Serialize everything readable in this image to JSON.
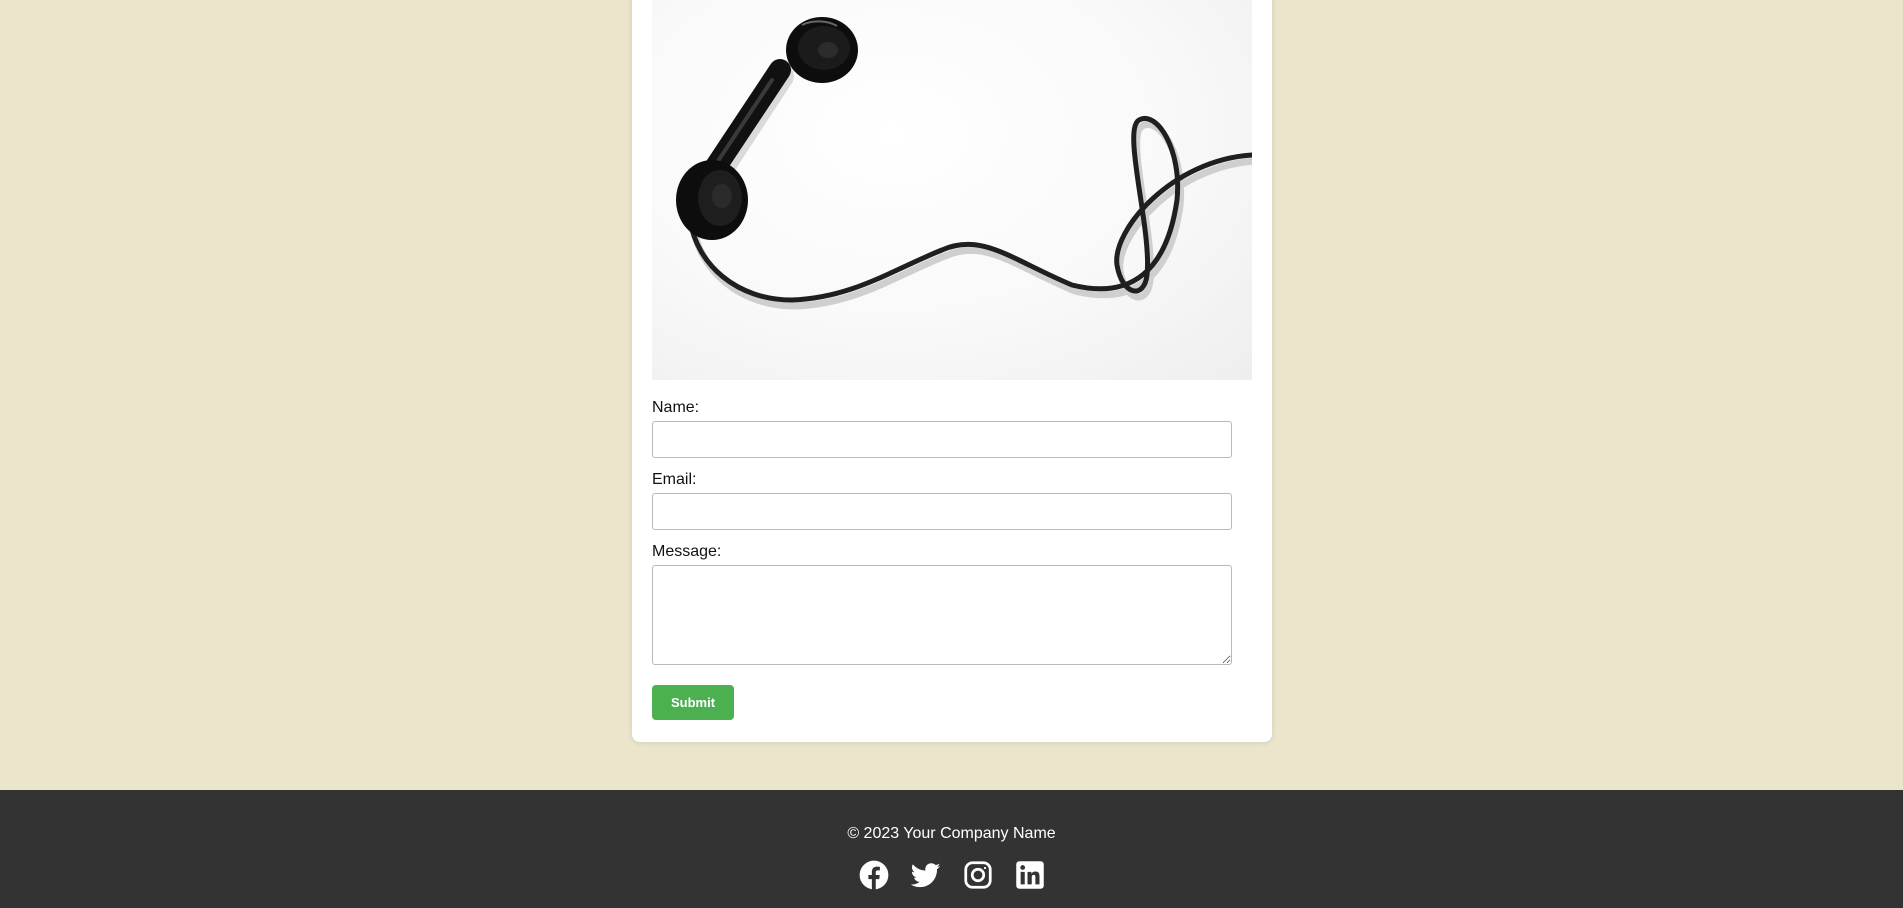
{
  "contact_form": {
    "name_label": "Name:",
    "name_value": "",
    "email_label": "Email:",
    "email_value": "",
    "message_label": "Message:",
    "message_value": "",
    "submit_label": "Submit"
  },
  "footer": {
    "copyright": "© 2023 Your Company Name",
    "social_links": [
      {
        "icon": "facebook-icon"
      },
      {
        "icon": "twitter-icon"
      },
      {
        "icon": "instagram-icon"
      },
      {
        "icon": "linkedin-icon"
      }
    ]
  },
  "colors": {
    "page_background": "#ebe5cc",
    "card_background": "#ffffff",
    "submit_button": "#4caf50",
    "footer_background": "#333333",
    "footer_text": "#ffffff"
  }
}
